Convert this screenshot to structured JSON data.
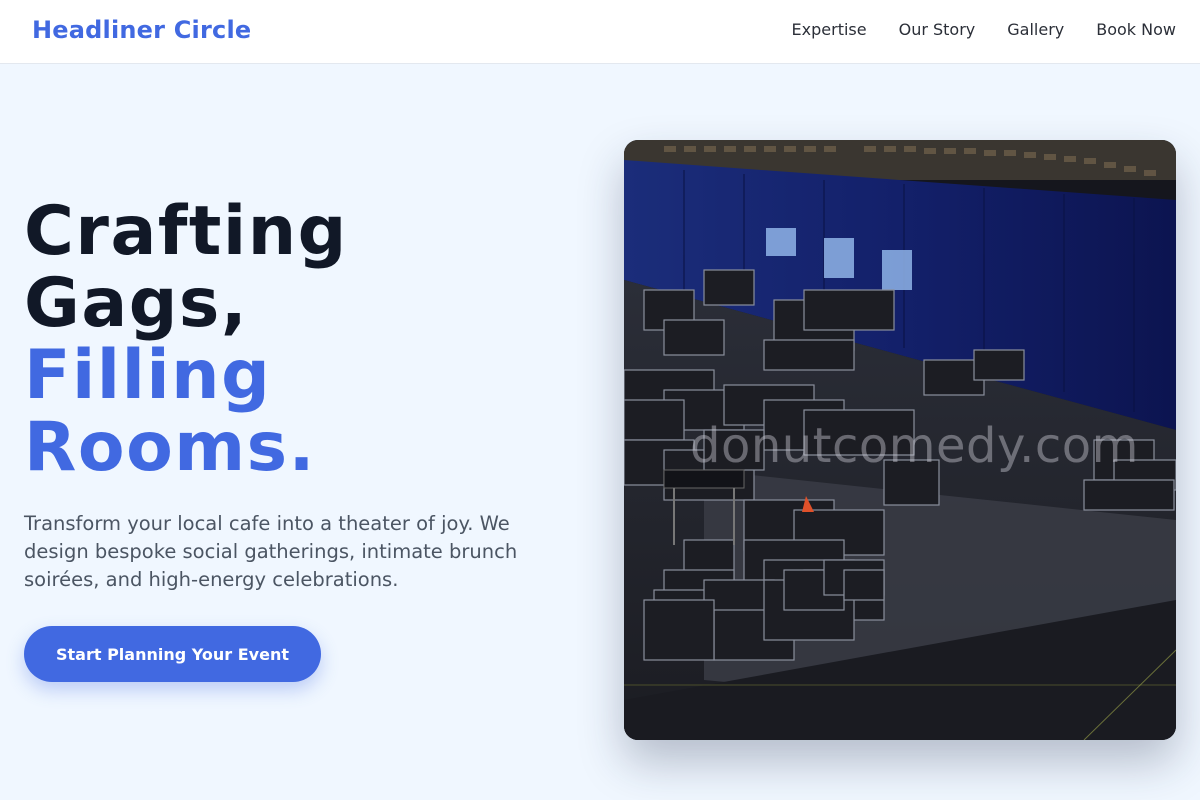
{
  "header": {
    "brand": "Headliner Circle",
    "nav": [
      "Expertise",
      "Our Story",
      "Gallery",
      "Book Now"
    ]
  },
  "hero": {
    "title_lines": [
      "Crafting",
      "Gags,",
      "Filling",
      "Rooms."
    ],
    "description": "Transform your local cafe into a theater of joy. We design bespoke social gatherings, intimate brunch soirées, and high-energy celebrations.",
    "cta_label": "Start Planning Your Event"
  },
  "image": {
    "subject": "arena stage floor with road cases",
    "watermark": "donutcomedy.com"
  },
  "colors": {
    "accent": "#4169e1",
    "heading": "#111827",
    "text": "#4b5563",
    "background": "#f0f7ff",
    "header_bg": "#ffffff"
  }
}
